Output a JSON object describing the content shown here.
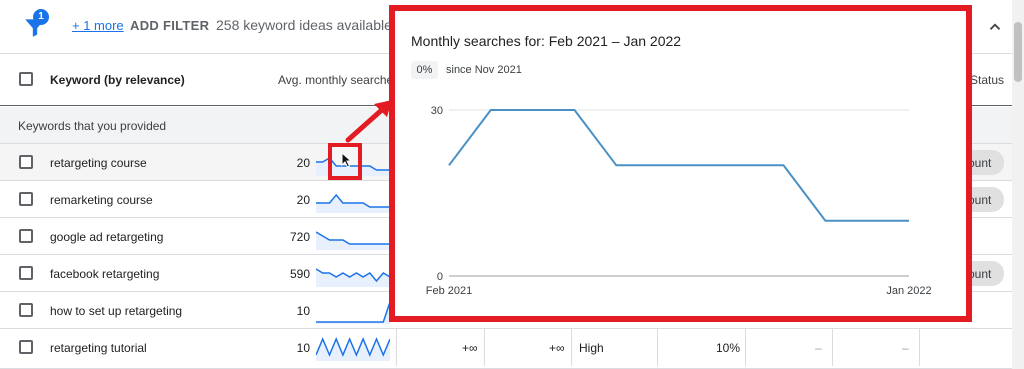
{
  "filter_bar": {
    "badge": "1",
    "more_link": "+ 1 more",
    "add_filter": "ADD FILTER",
    "ideas": "258 keyword ideas available"
  },
  "table": {
    "headers": {
      "keyword": "Keyword (by relevance)",
      "avg": "Avg. monthly searches",
      "status": "Status"
    },
    "group_label": "Keywords that you provided",
    "rows": [
      {
        "keyword": "retargeting course",
        "avg": "20",
        "trend": [
          3,
          3,
          4,
          2,
          2,
          2,
          2,
          2,
          2,
          1,
          1,
          1
        ],
        "pill": "ount"
      },
      {
        "keyword": "remarketing course",
        "avg": "20",
        "trend": [
          2,
          2,
          2,
          4,
          2,
          2,
          2,
          2,
          1,
          1,
          1,
          1
        ],
        "pill": "ount"
      },
      {
        "keyword": "google ad retargeting",
        "avg": "720",
        "trend": [
          4,
          3,
          2,
          2,
          2,
          1,
          1,
          1,
          1,
          1,
          1,
          1
        ],
        "pill": ""
      },
      {
        "keyword": "facebook retargeting",
        "avg": "590",
        "trend": [
          4,
          3,
          3,
          2,
          3,
          2,
          3,
          2,
          3,
          1,
          3,
          2
        ],
        "pill": "ount"
      },
      {
        "keyword": "how to set up retargeting",
        "avg": "10",
        "trend": [
          0,
          0,
          0,
          0,
          0,
          0,
          0,
          0,
          0,
          0,
          0,
          5
        ],
        "pill": ""
      },
      {
        "keyword": "retargeting tutorial",
        "avg": "10",
        "trend": [
          1,
          5,
          1,
          5,
          1,
          5,
          1,
          5,
          1,
          5,
          1,
          5
        ],
        "pill": ""
      }
    ],
    "last_row_cells": {
      "change_3m": "+∞",
      "change_yoy": "+∞",
      "competition": "High",
      "impr_share": "10%",
      "bid_low": "–",
      "bid_high": "–"
    }
  },
  "popup": {
    "title": "Monthly searches for: Feb 2021 – Jan 2022",
    "chip": "0%",
    "since": "since Nov 2021"
  },
  "chart_data": {
    "type": "line",
    "title": "Monthly searches for: Feb 2021 – Jan 2022",
    "x": [
      "Feb 2021",
      "Mar 2021",
      "Apr 2021",
      "May 2021",
      "Jun 2021",
      "Jul 2021",
      "Aug 2021",
      "Sep 2021",
      "Oct 2021",
      "Nov 2021",
      "Dec 2021",
      "Jan 2022"
    ],
    "x_tick_labels": [
      "Feb 2021",
      "Jan 2022"
    ],
    "series": [
      {
        "values": [
          20,
          30,
          30,
          30,
          20,
          20,
          20,
          20,
          20,
          10,
          10,
          10
        ]
      }
    ],
    "ylim": [
      0,
      30
    ],
    "y_ticks": [
      "30",
      "0"
    ],
    "grid": true,
    "color": "#4a90c4"
  },
  "colors": {
    "accent": "#1a73e8",
    "highlight_red": "#e31b23",
    "sparkline": "#1a73e8"
  }
}
